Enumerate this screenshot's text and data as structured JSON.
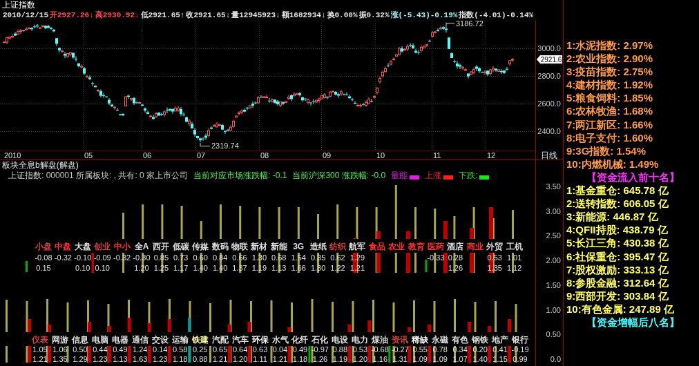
{
  "header": {
    "title": "上证指数",
    "quote": [
      {
        "text": "2010/12/15",
        "color": "#e0e0e0"
      },
      {
        "text": "开2927.26↓",
        "color": "#ff5050"
      },
      {
        "text": "高2930.92↓",
        "color": "#ff5050"
      },
      {
        "text": "低2921.65↑",
        "color": "#e0e0e0"
      },
      {
        "text": "收2921.65↓",
        "color": "#e0e0e0"
      },
      {
        "text": "量12945923↓",
        "color": "#e0e0e0"
      },
      {
        "text": "额1682934↓",
        "color": "#e0e0e0"
      },
      {
        "text": "换0.00%",
        "color": "#e0e0e0"
      },
      {
        "text": "振0.32%",
        "color": "#e0e0e0"
      },
      {
        "text": "涨(-5.43)-0.19%",
        "color": "#a0f0f0"
      },
      {
        "text": "指数(-4.01)-0.14%",
        "color": "#e0e0e0"
      }
    ]
  },
  "price_chart": {
    "axis_labels": [
      "3000.0",
      "2800.0",
      "2600.0",
      "2400.0"
    ],
    "last_price": "2921.6",
    "high_label": "3186.72",
    "low_label": "2319.74",
    "date_labels": [
      "2010",
      "05",
      "06",
      "07",
      "08",
      "09",
      "10",
      "11",
      "12"
    ],
    "period": "日线"
  },
  "sector_panel": {
    "title": "板块全息b解盘(解盘)",
    "info": "上证指数:  000001 所属板块: , 共有: 0 家上市公司",
    "market_change": "当前对应市场涨跌幅: -0.1",
    "hs300_change": "当前沪深300 涨跌幅: -0.0",
    "legend": [
      {
        "label": "量能",
        "color": "#e020e0"
      },
      {
        "label": "上涨",
        "color": "#ff2020"
      },
      {
        "label": "下跌:",
        "color": "#20e020"
      }
    ],
    "axis_labels": [
      "3.50",
      "3.00",
      "2.50",
      "2.00",
      "1.50",
      "1.00",
      "0.50",
      "0.0"
    ],
    "sectors_upper": [
      {
        "name": "小盘",
        "value_1": "-0.08",
        "value_2": "0.15",
        "color": "#d04040"
      },
      {
        "name": "中盘",
        "value_1": "-0.32",
        "color": "#ff3030"
      },
      {
        "name": "大盘",
        "value_1": "-0.10",
        "value_2": "0.10",
        "color": "#e0e0e0"
      },
      {
        "name": "创业",
        "value_1": "-0.09",
        "value_2": "0.10",
        "color": "#d04040"
      },
      {
        "name": "中小",
        "value_1": "-0.32",
        "color": "#ff3030"
      },
      {
        "name": "全A",
        "value_1": "-0.30",
        "value_2": "1.20",
        "color": "#e0e0e0"
      },
      {
        "name": "西开",
        "value_1": "0.85",
        "value_2": "1.25",
        "color": "#e0e0e0"
      },
      {
        "name": "低碳",
        "value_1": "0.73",
        "value_2": "1.17",
        "color": "#e0e0e0"
      },
      {
        "name": "传媒",
        "value_1": "0.60",
        "value_2": "1.40",
        "color": "#e0e0e0"
      },
      {
        "name": "数码",
        "value_1": "0.84",
        "value_2": "1.40",
        "color": "#e0e0e0"
      },
      {
        "name": "物联",
        "value_1": "0.66",
        "value_2": "1.37",
        "color": "#e0e0e0"
      },
      {
        "name": "新材",
        "value_1": "1.30",
        "value_2": "1.19",
        "color": "#e0e0e0"
      },
      {
        "name": "新能",
        "value_1": "0.68",
        "value_2": "1.13",
        "color": "#e0e0e0"
      },
      {
        "name": "3G",
        "value_1": "1.54",
        "value_2": "1.66",
        "color": "#e0e0e0"
      },
      {
        "name": "造纸",
        "value_1": "0.35",
        "value_2": "1.30",
        "color": "#e0e0e0"
      },
      {
        "name": "纺织",
        "value_1": "0.62",
        "value_2": "1.22",
        "color": "#d04040"
      },
      {
        "name": "航军",
        "value_1": "1.29",
        "value_2": "1.21",
        "color": "#e0e0e0"
      },
      {
        "name": "食品",
        "color": "#ff3030"
      },
      {
        "name": "农业",
        "color": "#ff3030"
      },
      {
        "name": "教育",
        "color": "#ff3030"
      },
      {
        "name": "医药",
        "value_1": "-0.33",
        "color": "#ff3030"
      },
      {
        "name": "酒店",
        "value_1": "0.28",
        "value_2": "1.26",
        "color": "#e0e0e0"
      },
      {
        "name": "商业",
        "color": "#ff3030"
      },
      {
        "name": "外贸",
        "value_1": "0.53",
        "value_2": "1.35",
        "color": "#e0e0e0"
      },
      {
        "name": "工机",
        "value_1": "1.01",
        "value_2": "1.12",
        "color": "#e0e0e0"
      }
    ],
    "sectors_lower": [
      {
        "name": "仪表",
        "value_1": "1.05",
        "value_2": "1.21",
        "color": "#d04040"
      },
      {
        "name": "网游",
        "value_1": "1.06",
        "value_2": "1.35",
        "color": "#e0e0e0"
      },
      {
        "name": "信息",
        "value_1": "0.50",
        "value_2": "1.29",
        "color": "#e0e0e0"
      },
      {
        "name": "电脑",
        "value_1": "0.44",
        "value_2": "1.23",
        "color": "#e0e0e0"
      },
      {
        "name": "电器",
        "value_1": "0.49",
        "value_2": "1.13",
        "color": "#e0e0e0"
      },
      {
        "name": "通信",
        "value_1": "1.24",
        "value_2": "1.63",
        "color": "#e0e0e0"
      },
      {
        "name": "交设",
        "value_1": "0.14",
        "value_2": "1.23",
        "color": "#e0e0e0"
      },
      {
        "name": "运输",
        "value_1": "0.58",
        "value_2": "1.18",
        "color": "#e0e0e0"
      },
      {
        "name": "铁建",
        "value_1": "0.25",
        "value_2": "0.88",
        "color": "#ffffa0"
      },
      {
        "name": "汽配",
        "value_1": "0.65",
        "value_2": "1.21",
        "color": "#e0e0e0"
      },
      {
        "name": "汽车",
        "value_1": "0.64",
        "value_2": "1.20",
        "color": "#e0e0e0"
      },
      {
        "name": "环保",
        "value_1": "0.63",
        "value_2": "1.11",
        "color": "#ffffff"
      },
      {
        "name": "水气",
        "value_1": "0.04",
        "value_2": "1.21",
        "color": "#e0e0e0"
      },
      {
        "name": "化纤",
        "value_1": "0.49",
        "value_2": "1.18",
        "color": "#e0e0e0"
      },
      {
        "name": "石化",
        "value_1": "-0.97",
        "value_2": "1.26",
        "color": "#e0e0e0"
      },
      {
        "name": "电设",
        "value_1": "0.88",
        "value_2": "1.19",
        "color": "#e0e0e0"
      },
      {
        "name": "电力",
        "value_1": "0.53",
        "value_2": "1.20",
        "color": "#e0e0e0"
      },
      {
        "name": "煤油",
        "value_1": "-0.68",
        "value_2": "1.16",
        "color": "#e0e0e0"
      },
      {
        "name": "资讯",
        "value_1": "-0.27",
        "value_2": "1.31",
        "color": "#d04040"
      },
      {
        "name": "稀缺",
        "value_1": "0.55",
        "value_2": "1.09",
        "color": "#ffffff"
      },
      {
        "name": "永磁",
        "value_1": "0.78",
        "value_2": "1.09",
        "color": "#e0e0e0"
      },
      {
        "name": "有色",
        "value_1": "0.34",
        "value_2": "1.07",
        "color": "#e0e0e0"
      },
      {
        "name": "钢铁",
        "value_1": "0.20",
        "value_2": "1.40",
        "color": "#e0e0e0"
      },
      {
        "name": "地产",
        "value_1": "0.41",
        "value_2": "1.15",
        "color": "#e0e0e0"
      },
      {
        "name": "银行",
        "value_1": "-0.19",
        "value_2": "0.99",
        "color": "#e0e0e0"
      }
    ]
  },
  "ranking": {
    "gainers": [
      "1:水泥指数: 2.97%",
      "2:农业指数: 2.90%",
      "3:疫苗指数: 2.75%",
      "4:建材指数: 1.92%",
      "5:粮食饲料: 1.85%",
      "6:农林牧渔: 1.68%",
      "7:两江新区: 1.66%",
      "8:电子支付: 1.60%",
      "9:3G指数: 1.54%",
      "10:内燃机械: 1.49%"
    ],
    "inflow_title": "【资金流入前十名】",
    "inflow": [
      "1:基金重仓: 645.78 亿",
      "2:送转指数: 606.05 亿",
      "3:新能源: 446.87 亿",
      "4:QFII持股: 438.79 亿",
      "5:长江三角: 430.38 亿",
      "6:社保重仓: 395.47 亿",
      "7:股权激励: 333.13 亿",
      "8:参股金融: 312.64 亿",
      "9:西部开发: 303.84 亿",
      "10:有色金属: 247.89 亿"
    ],
    "growth_title": "【资金增幅后八名】"
  }
}
